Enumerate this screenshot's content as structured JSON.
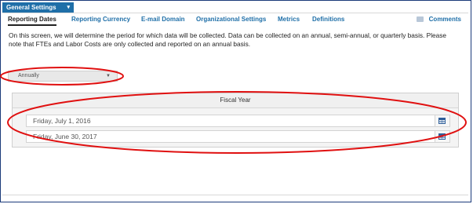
{
  "topbar": {
    "title": "General Settings"
  },
  "tabs": [
    {
      "label": "Reporting Dates"
    },
    {
      "label": "Reporting Currency"
    },
    {
      "label": "E-mail Domain"
    },
    {
      "label": "Organizational Settings"
    },
    {
      "label": "Metrics"
    },
    {
      "label": "Definitions"
    }
  ],
  "comments": {
    "label": "Comments"
  },
  "description": "On this screen, we will determine the period for which data will be collected. Data can be collected on an annual, semi-annual, or quarterly basis. Please note that FTEs and Labor Costs are only collected and reported on an annual basis.",
  "frequency_select": {
    "value": "Annually"
  },
  "fiscal_year": {
    "header": "Fiscal Year",
    "start_date": "Friday, July 1, 2016",
    "end_date": "Friday, June 30, 2017"
  },
  "colors": {
    "accent": "#1f6fa8",
    "annotation": "#e01010"
  }
}
